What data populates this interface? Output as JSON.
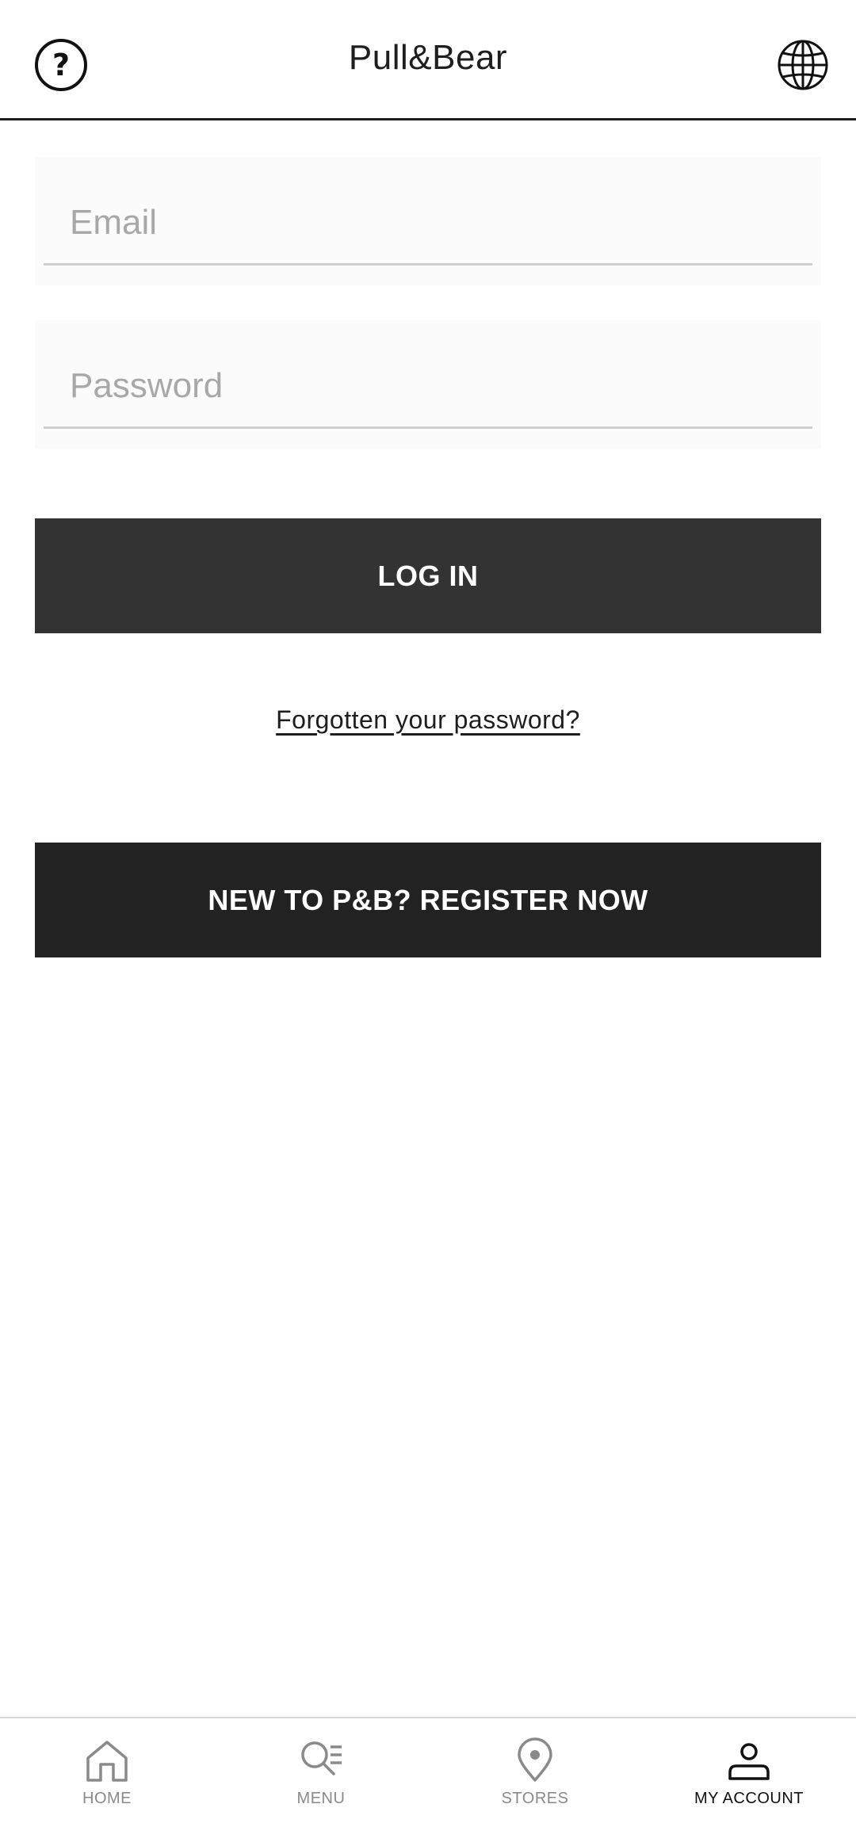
{
  "header": {
    "title": "Pull&Bear",
    "help_icon": "question-circle-icon",
    "language_icon": "globe-icon"
  },
  "form": {
    "email": {
      "placeholder": "Email",
      "value": ""
    },
    "password": {
      "placeholder": "Password",
      "value": ""
    },
    "login_label": "LOG IN",
    "forgot_label": "Forgotten your password?",
    "register_label": "NEW TO P&B? REGISTER NOW"
  },
  "bottom_nav": {
    "items": [
      {
        "label": "HOME",
        "icon": "home-icon",
        "active": false
      },
      {
        "label": "MENU",
        "icon": "search-menu-icon",
        "active": false
      },
      {
        "label": "STORES",
        "icon": "location-pin-icon",
        "active": false
      },
      {
        "label": "MY ACCOUNT",
        "icon": "user-icon",
        "active": true
      }
    ]
  },
  "colors": {
    "login_button": "#333333",
    "register_button": "#222222",
    "inactive_nav": "#8a8a8a",
    "active_nav": "#111111"
  }
}
